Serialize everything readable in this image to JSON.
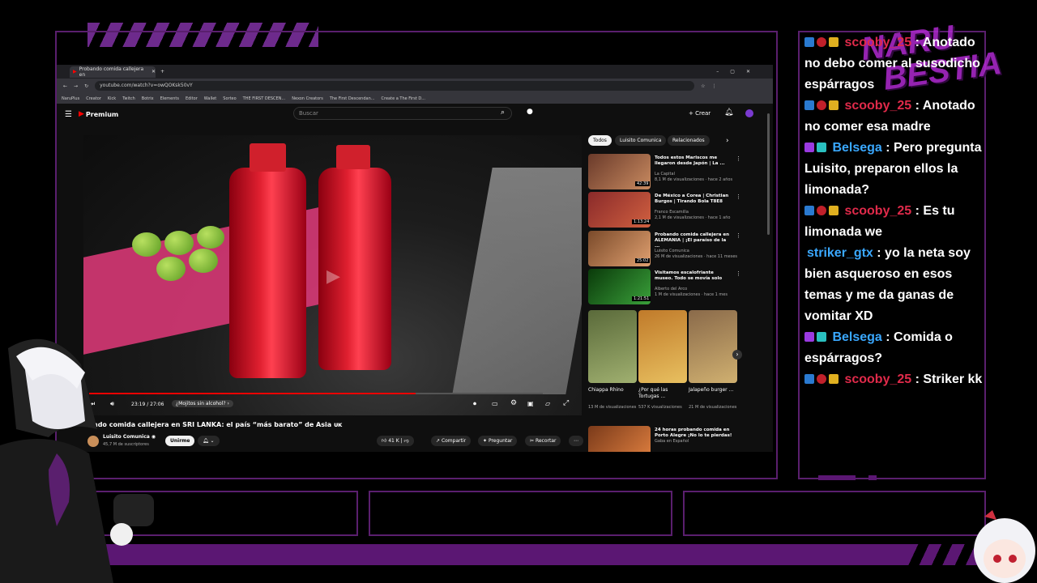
{
  "overlay": {
    "logo_line1": "NARU",
    "logo_line2": "BESTIA"
  },
  "browser": {
    "tab_title": "Probando comida callejera en",
    "url": "youtube.com/watch?v=owQOKsk50vY",
    "bookmarks": [
      "NaruPlus",
      "Creator",
      "Kick",
      "Twitch",
      "Botrix",
      "Elements",
      "Editor",
      "Wallet",
      "Sorteo",
      "THE FIRST DESCEN...",
      "Nexon Creators",
      "The First Descendan...",
      "Create a The First D..."
    ]
  },
  "youtube": {
    "brand": "Premium",
    "search_placeholder": "Buscar",
    "create_label": "Crear",
    "video_time": "23:19 / 27:06",
    "chapter": "¿Mojitos sin alcohol?",
    "video_title": "ndo comida callejera en SRI LANKA: el país “más barato” de Asia",
    "channel_name": "Luisito Comunica",
    "subscribers": "45,7 M de suscriptores",
    "join_label": "Unirme",
    "likes": "41 K",
    "share": "Compartir",
    "ask": "Preguntar",
    "clip": "Recortar",
    "filters": [
      "Todos",
      "Luisito Comunica",
      "Relacionados"
    ],
    "recommended": [
      {
        "title": "Todos estos Mariscos me llegaron desde Japón | La ...",
        "channel": "La Capital",
        "meta": "8,1 M de visualizaciones · hace 2 años",
        "duration": "42:39"
      },
      {
        "title": "De México a Corea | Christian Burgos | Tirando Bola T8E8",
        "channel": "Franco Escamilla",
        "meta": "2,1 M de visualizaciones · hace 1 año",
        "duration": "1:13:24"
      },
      {
        "title": "Probando comida callejera en ALEMANIA | ¡El paraíso de la ...",
        "channel": "Luisito Comunica",
        "meta": "26 M de visualizaciones · hace 11 meses",
        "duration": "25:02"
      },
      {
        "title": "Visitamos escalofriante museo. Todo se movía solo",
        "channel": "Alberto del Arco",
        "meta": "1 M de visualizaciones · hace 1 mes",
        "duration": "1:21:51"
      }
    ],
    "shorts": [
      {
        "title": "Chiappa Rhino",
        "views": "13 M de visualizaciones"
      },
      {
        "title": "¿Por qué las Tortugas ...",
        "views": "537 K visualizaciones"
      },
      {
        "title": "Jalapeño burger ...",
        "views": "21 M de visualizaciones"
      }
    ],
    "last_rec": {
      "title": "24 horas probando comida en Porto Alegre ¡No lo te pierdas!",
      "channel": "Gaba en Español"
    }
  },
  "chat": [
    {
      "user": "scooby_25",
      "color": "#e02a4a",
      "text": "Anotado no debo comer al susodicho espárragos"
    },
    {
      "user": "scooby_25",
      "color": "#e02a4a",
      "text": "Anotado no comer esa madre"
    },
    {
      "user": "Belsega",
      "color": "#3aa8ff",
      "text": "Pero pregunta Luisito, preparon ellos la limonada?"
    },
    {
      "user": "scooby_25",
      "color": "#e02a4a",
      "text": "Es tu limonada we"
    },
    {
      "user": "striker_gtx",
      "color": "#3aa8ff",
      "text": "yo la neta soy bien asqueroso en esos temas y me da ganas de vomitar XD"
    },
    {
      "user": "Belsega",
      "color": "#3aa8ff",
      "text": "Comida o espárragos?"
    },
    {
      "user": "scooby_25",
      "color": "#e02a4a",
      "text": "Striker kk"
    }
  ]
}
